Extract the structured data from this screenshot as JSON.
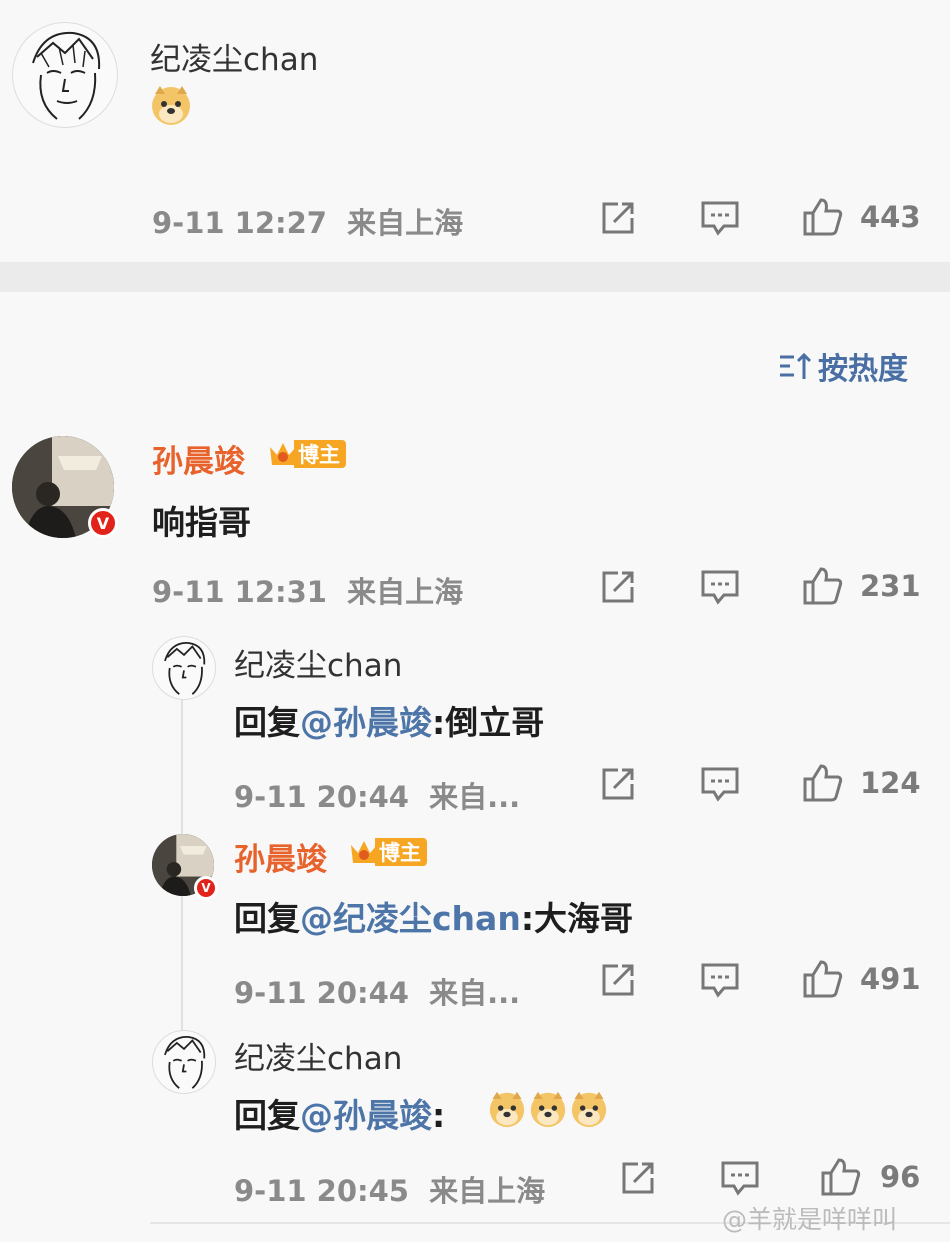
{
  "top_comment": {
    "username": "纪凌尘chan",
    "timestamp": "9-11 12:27",
    "location": "来自上海",
    "likes": "443"
  },
  "sort": {
    "label": "按热度"
  },
  "main_comment": {
    "username": "孙晨竣",
    "badge": "博主",
    "text": "响指哥",
    "timestamp": "9-11 12:31",
    "location": "来自上海",
    "likes": "231"
  },
  "replies": [
    {
      "username": "纪凌尘chan",
      "prefix": "回复",
      "mention": "@孙晨竣",
      "text": ":倒立哥",
      "timestamp": "9-11 20:44",
      "location": "来自...",
      "likes": "124"
    },
    {
      "username": "孙晨竣",
      "badge": "博主",
      "prefix": "回复",
      "mention": "@纪凌尘chan",
      "text": ":大海哥",
      "timestamp": "9-11 20:44",
      "location": "来自...",
      "likes": "491"
    },
    {
      "username": "纪凌尘chan",
      "prefix": "回复",
      "mention": "@孙晨竣",
      "text": ":",
      "timestamp": "9-11 20:45",
      "location": "来自上海",
      "likes": "96"
    }
  ],
  "watermark": "@羊就是咩咩叫",
  "colors": {
    "accent": "#4d75a8",
    "username_highlight": "#e8622c",
    "badge": "#f6a623",
    "verified": "#e2231a"
  }
}
